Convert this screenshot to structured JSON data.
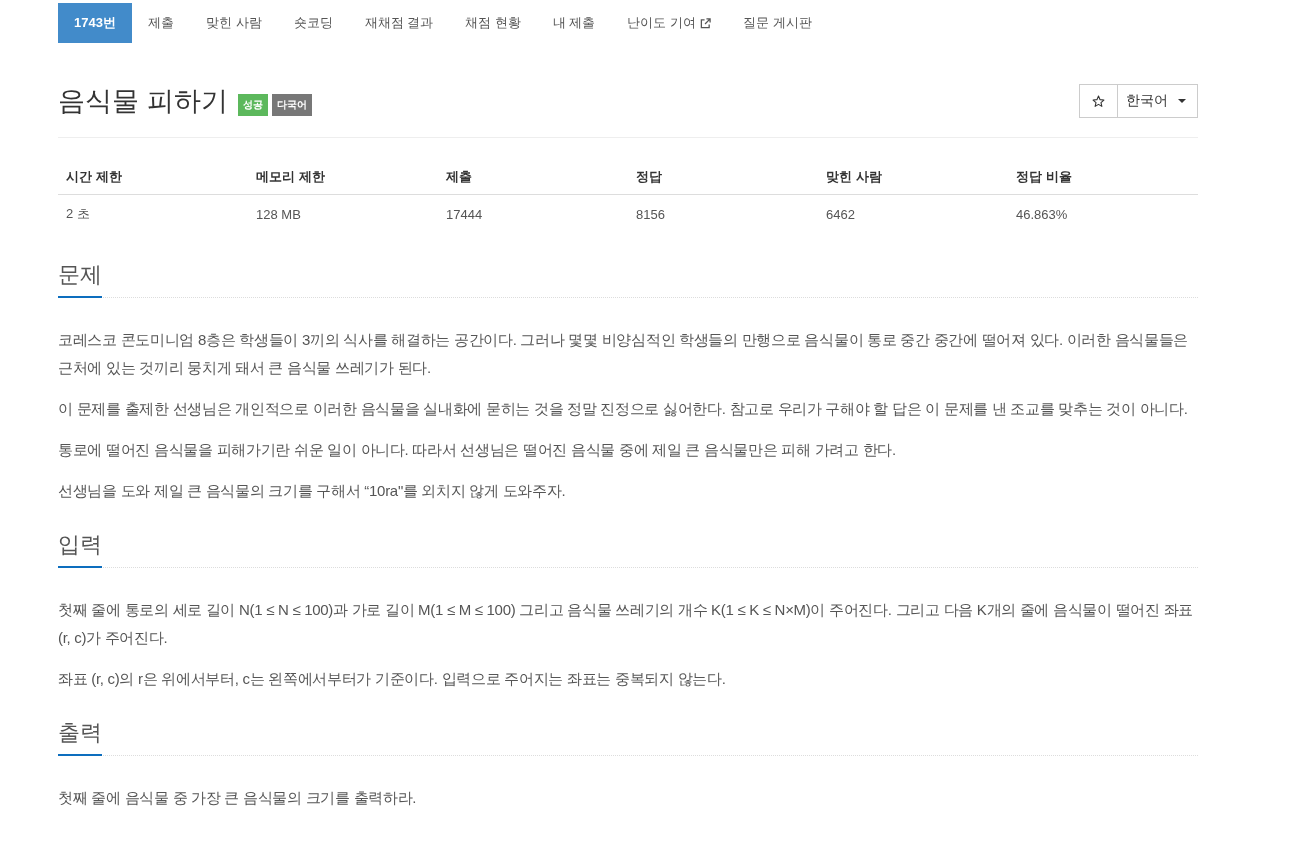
{
  "nav": {
    "tabs": [
      {
        "label": "1743번",
        "selected": true,
        "external_link": false
      },
      {
        "label": "제출",
        "selected": false,
        "external_link": false
      },
      {
        "label": "맞힌 사람",
        "selected": false,
        "external_link": false
      },
      {
        "label": "숏코딩",
        "selected": false,
        "external_link": false
      },
      {
        "label": "재채점 결과",
        "selected": false,
        "external_link": false
      },
      {
        "label": "채점 현황",
        "selected": false,
        "external_link": false
      },
      {
        "label": "내 제출",
        "selected": false,
        "external_link": false
      },
      {
        "label": "난이도 기여",
        "selected": false,
        "external_link": true
      },
      {
        "label": "질문 게시판",
        "selected": false,
        "external_link": false
      }
    ]
  },
  "problem": {
    "title": "음식물 피하기",
    "badges": [
      {
        "label": "성공",
        "color": "#5cb85c"
      },
      {
        "label": "다국어",
        "color": "#777777"
      }
    ]
  },
  "actions": {
    "starred": false,
    "language": "한국어"
  },
  "info_table": {
    "columns": [
      "시간 제한",
      "메모리 제한",
      "제출",
      "정답",
      "맞힌 사람",
      "정답 비율"
    ],
    "rows": [
      [
        "2 초",
        "128 MB",
        "17444",
        "8156",
        "6462",
        "46.863%"
      ]
    ]
  },
  "sections": [
    {
      "title": "문제",
      "paragraphs": [
        "코레스코 콘도미니엄 8층은 학생들이 3끼의 식사를 해결하는 공간이다. 그러나 몇몇 비양심적인 학생들의 만행으로 음식물이 통로 중간 중간에 떨어져 있다. 이러한 음식물들은 근처에 있는 것끼리 뭉치게 돼서 큰 음식물 쓰레기가 된다.",
        "이 문제를 출제한 선생님은 개인적으로 이러한 음식물을 실내화에 묻히는 것을 정말 진정으로 싫어한다. 참고로 우리가 구해야 할 답은 이 문제를 낸 조교를 맞추는 것이 아니다.",
        "통로에 떨어진 음식물을 피해가기란 쉬운 일이 아니다. 따라서 선생님은 떨어진 음식물 중에 제일 큰 음식물만은 피해 가려고 한다.",
        "선생님을 도와 제일 큰 음식물의 크기를 구해서 “10ra\"를 외치지 않게 도와주자."
      ]
    },
    {
      "title": "입력",
      "paragraphs": [
        "첫째 줄에 통로의 세로 길이 N(1 ≤ N ≤ 100)과 가로 길이 M(1 ≤ M ≤ 100) 그리고 음식물 쓰레기의 개수 K(1 ≤ K ≤ N×M)이 주어진다.  그리고 다음 K개의 줄에 음식물이 떨어진 좌표 (r, c)가 주어진다.",
        "좌표 (r, c)의 r은 위에서부터, c는 왼쪽에서부터가 기준이다. 입력으로 주어지는 좌표는 중복되지 않는다."
      ]
    },
    {
      "title": "출력",
      "paragraphs": [
        "첫째 줄에 음식물 중 가장 큰 음식물의 크기를 출력하라."
      ]
    }
  ]
}
